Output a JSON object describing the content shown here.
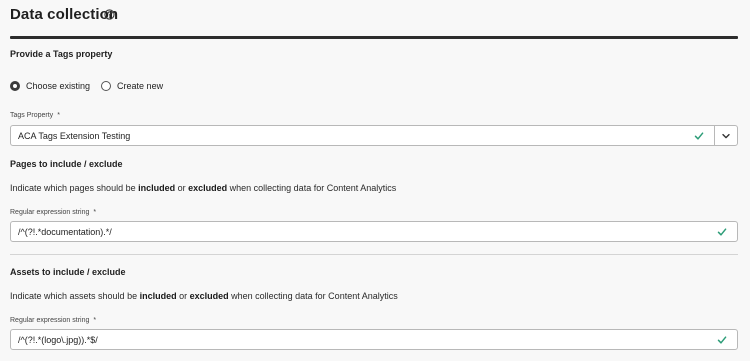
{
  "page": {
    "title": "Data collection"
  },
  "tags_section": {
    "title": "Provide a Tags property",
    "radio_options": [
      {
        "label": "Choose existing",
        "checked": true
      },
      {
        "label": "Create new",
        "checked": false
      }
    ],
    "property_field": {
      "label": "Tags Property",
      "required_mark": "*",
      "value": "ACA Tags Extension Testing"
    }
  },
  "pages_section": {
    "title": "Pages to include / exclude",
    "desc_prefix": "Indicate which pages should be ",
    "included": "included",
    "or": " or ",
    "excluded": "excluded",
    "desc_suffix": " when collecting data for Content Analytics",
    "regex_field": {
      "label": "Regular expression string",
      "required_mark": "*",
      "value": "/^(?!.*documentation).*/"
    }
  },
  "assets_section": {
    "title": "Assets to include / exclude",
    "desc_prefix": "Indicate which assets should be ",
    "included": "included",
    "or": " or ",
    "excluded": "excluded",
    "desc_suffix": " when collecting data for Content Analytics",
    "regex_field": {
      "label": "Regular expression string",
      "required_mark": "*",
      "value": "/^(?!.*(logo\\.jpg)).*$/"
    }
  },
  "icons": {
    "help": "help-circle-icon",
    "check": "checkmark-icon",
    "dropdown": "chevron-down-icon"
  },
  "colors": {
    "valid_check": "#2d9d78",
    "rule": "#2c2c2c"
  }
}
